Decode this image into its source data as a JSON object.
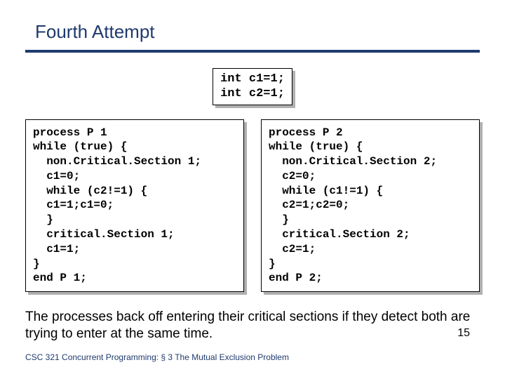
{
  "title": "Fourth Attempt",
  "shared_code": "int c1=1;\nint c2=1;",
  "p1_code": "process P 1\nwhile (true) {\n  non.Critical.Section 1;\n  c1=0;\n  while (c2!=1) {\n  c1=1;c1=0;\n  }\n  critical.Section 1;\n  c1=1;\n}\nend P 1;",
  "p2_code": "process P 2\nwhile (true) {\n  non.Critical.Section 2;\n  c2=0;\n  while (c1!=1) {\n  c2=1;c2=0;\n  }\n  critical.Section 2;\n  c2=1;\n}\nend P 2;",
  "caption": "The processes back off entering their critical sections if they detect both are trying to enter at the same time.",
  "footer": "CSC 321 Concurrent Programming: § 3 The Mutual Exclusion Problem",
  "page_number": "15"
}
